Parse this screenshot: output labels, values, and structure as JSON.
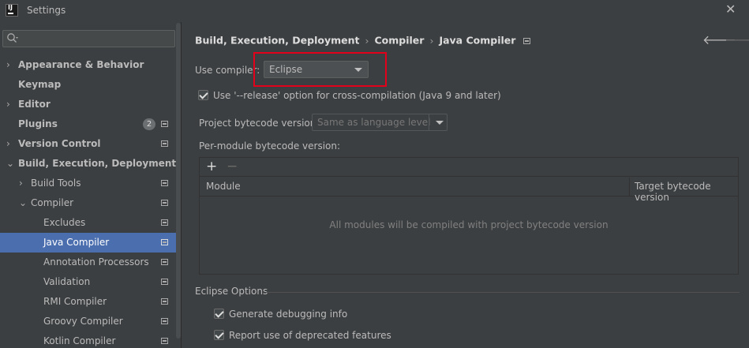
{
  "window": {
    "title": "Settings"
  },
  "sidebar": {
    "items": [
      {
        "label": "Appearance & Behavior"
      },
      {
        "label": "Keymap"
      },
      {
        "label": "Editor"
      },
      {
        "label": "Plugins",
        "badge": "2"
      },
      {
        "label": "Version Control"
      },
      {
        "label": "Build, Execution, Deployment"
      },
      {
        "label": "Build Tools"
      },
      {
        "label": "Compiler"
      },
      {
        "label": "Excludes"
      },
      {
        "label": "Java Compiler"
      },
      {
        "label": "Annotation Processors"
      },
      {
        "label": "Validation"
      },
      {
        "label": "RMI Compiler"
      },
      {
        "label": "Groovy Compiler"
      },
      {
        "label": "Kotlin Compiler"
      }
    ]
  },
  "breadcrumb": {
    "part1": "Build, Execution, Deployment",
    "part2": "Compiler",
    "part3": "Java Compiler"
  },
  "compiler": {
    "use_compiler_label": "Use compiler:",
    "use_compiler_value": "Eclipse",
    "release_option_label": "Use '--release' option for cross-compilation (Java 9 and later)",
    "project_bytecode_label": "Project bytecode version:",
    "project_bytecode_value": "Same as language level",
    "per_module_label": "Per-module bytecode version:"
  },
  "table": {
    "columns": [
      "Module",
      "Target bytecode version"
    ],
    "empty_text": "All modules will be compiled with project bytecode version"
  },
  "eclipse_options": {
    "title": "Eclipse Options",
    "generate_debug_label": "Generate debugging info",
    "report_deprecated_label": "Report use of deprecated features"
  },
  "colors": {
    "selection": "#4b6eaf",
    "highlight_box": "#e3001b",
    "background": "#3c3f41"
  }
}
